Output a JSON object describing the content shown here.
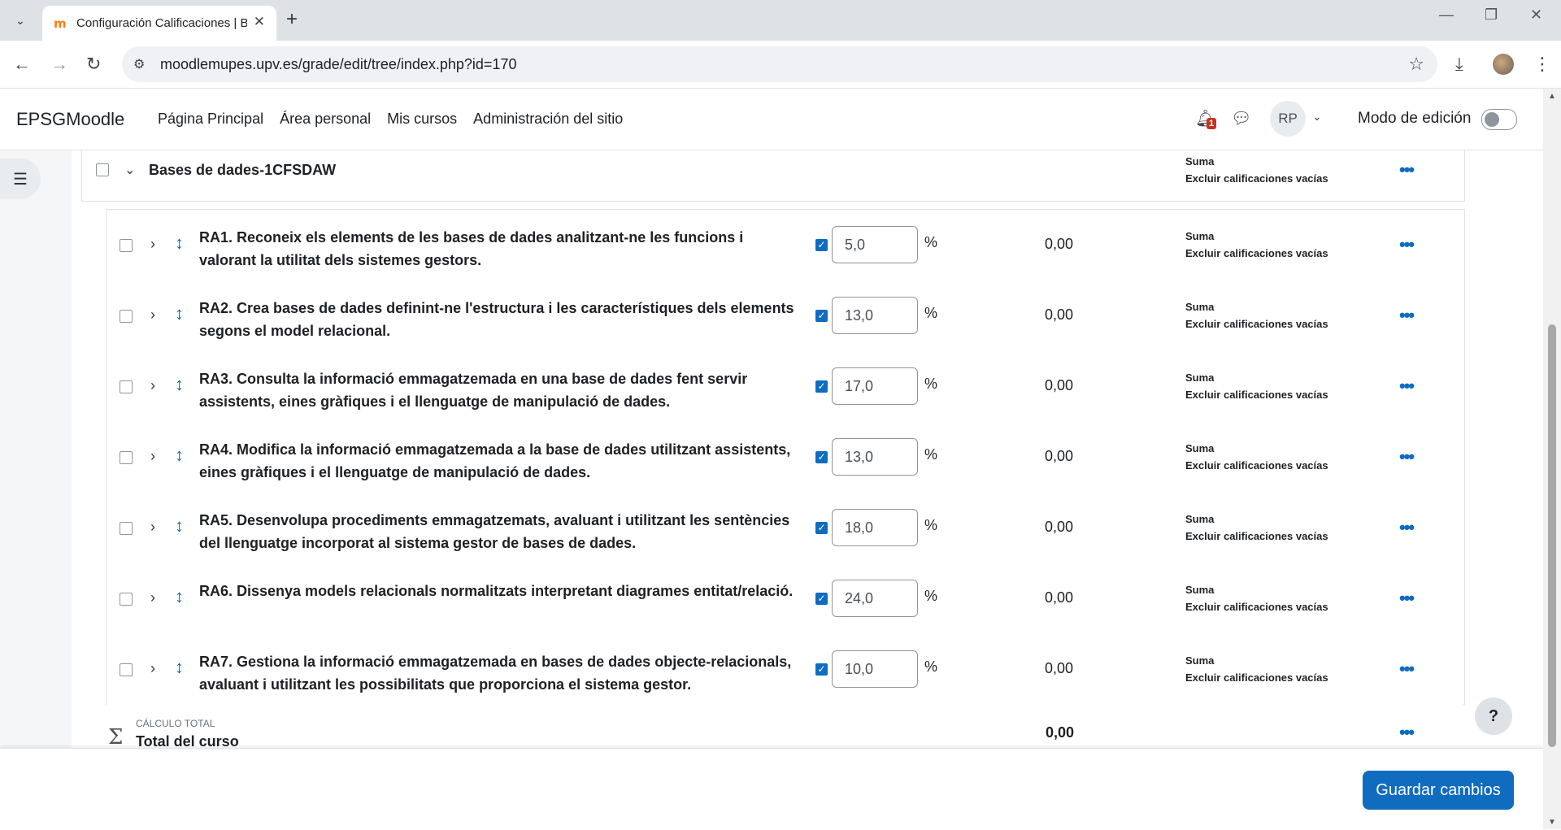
{
  "browser": {
    "tab_title": "Configuración Calificaciones | B",
    "url": "moodlemupes.upv.es/grade/edit/tree/index.php?id=170"
  },
  "navbar": {
    "brand": "EPSGMoodle",
    "links": [
      "Página Principal",
      "Área personal",
      "Mis cursos",
      "Administración del sitio"
    ],
    "notification_count": "1",
    "user_initials": "RP",
    "edit_mode_label": "Modo de edición",
    "edit_mode_on": false
  },
  "category": {
    "name": "Bases de dades-1CFSDAW",
    "aggregation": "Suma",
    "aggregation_note": "Excluir calificaciones vacías"
  },
  "items": [
    {
      "name": "RA1. Reconeix els elements de les bases de dades analitzant-ne les funcions i valorant la utilitat dels sistemes gestors.",
      "weight": "5,0",
      "value": "0,00",
      "aggregation": "Suma",
      "aggregation_note": "Excluir calificaciones vacías"
    },
    {
      "name": "RA2. Crea bases de dades definint-ne l'estructura i les característiques dels elements segons el model relacional.",
      "weight": "13,0",
      "value": "0,00",
      "aggregation": "Suma",
      "aggregation_note": "Excluir calificaciones vacías"
    },
    {
      "name": "RA3. Consulta la informació emmagatzemada en una base de dades fent servir assistents, eines gràfiques i el llenguatge de manipulació de dades.",
      "weight": "17,0",
      "value": "0,00",
      "aggregation": "Suma",
      "aggregation_note": "Excluir calificaciones vacías"
    },
    {
      "name": "RA4. Modifica la informació emmagatzemada a la base de dades utilitzant assistents, eines gràfiques i el llenguatge de manipulació de dades.",
      "weight": "13,0",
      "value": "0,00",
      "aggregation": "Suma",
      "aggregation_note": "Excluir calificaciones vacías"
    },
    {
      "name": "RA5. Desenvolupa procediments emmagatzemats, avaluant i utilitzant les sentències del llenguatge incorporat al sistema gestor de bases de dades.",
      "weight": "18,0",
      "value": "0,00",
      "aggregation": "Suma",
      "aggregation_note": "Excluir calificaciones vacías"
    },
    {
      "name": "RA6. Dissenya models relacionals normalitzats interpretant diagrames entitat/relació.",
      "weight": "24,0",
      "value": "0,00",
      "aggregation": "Suma",
      "aggregation_note": "Excluir calificaciones vacías"
    },
    {
      "name": "RA7. Gestiona la informació emmagatzemada en bases de dades objecte-relacionals, avaluant i utilitzant les possibilitats que proporciona el sistema gestor.",
      "weight": "10,0",
      "value": "0,00",
      "aggregation": "Suma",
      "aggregation_note": "Excluir calificaciones vacías"
    }
  ],
  "weight_unit": "%",
  "total": {
    "label": "CÁLCULO TOTAL",
    "name": "Total del curso",
    "value": "0,00"
  },
  "footer": {
    "save_label": "Guardar cambios"
  },
  "help_label": "?",
  "colors": {
    "accent": "#0f6cbf",
    "badge": "#ca3120"
  }
}
